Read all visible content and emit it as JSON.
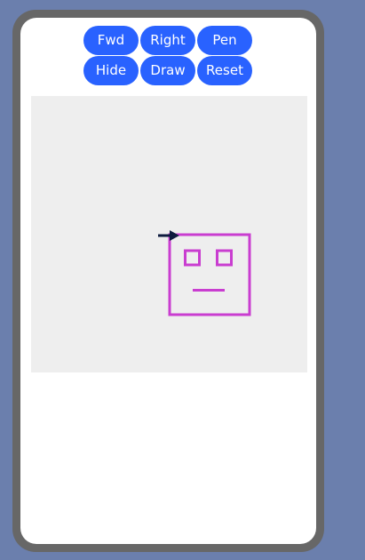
{
  "controls": {
    "row1": [
      "Fwd",
      "Right",
      "Pen"
    ],
    "row2": [
      "Hide",
      "Draw",
      "Reset"
    ]
  },
  "canvas": {
    "background": "#eeeeee",
    "drawing_color": "#c93dd0",
    "turtle_color": "#0d1b3e",
    "turtle_heading": "right",
    "drawing": "square face with two square eyes and a line mouth"
  },
  "colors": {
    "button": "#2962ff",
    "frame": "#676767",
    "page_background": "#6b7fad"
  }
}
